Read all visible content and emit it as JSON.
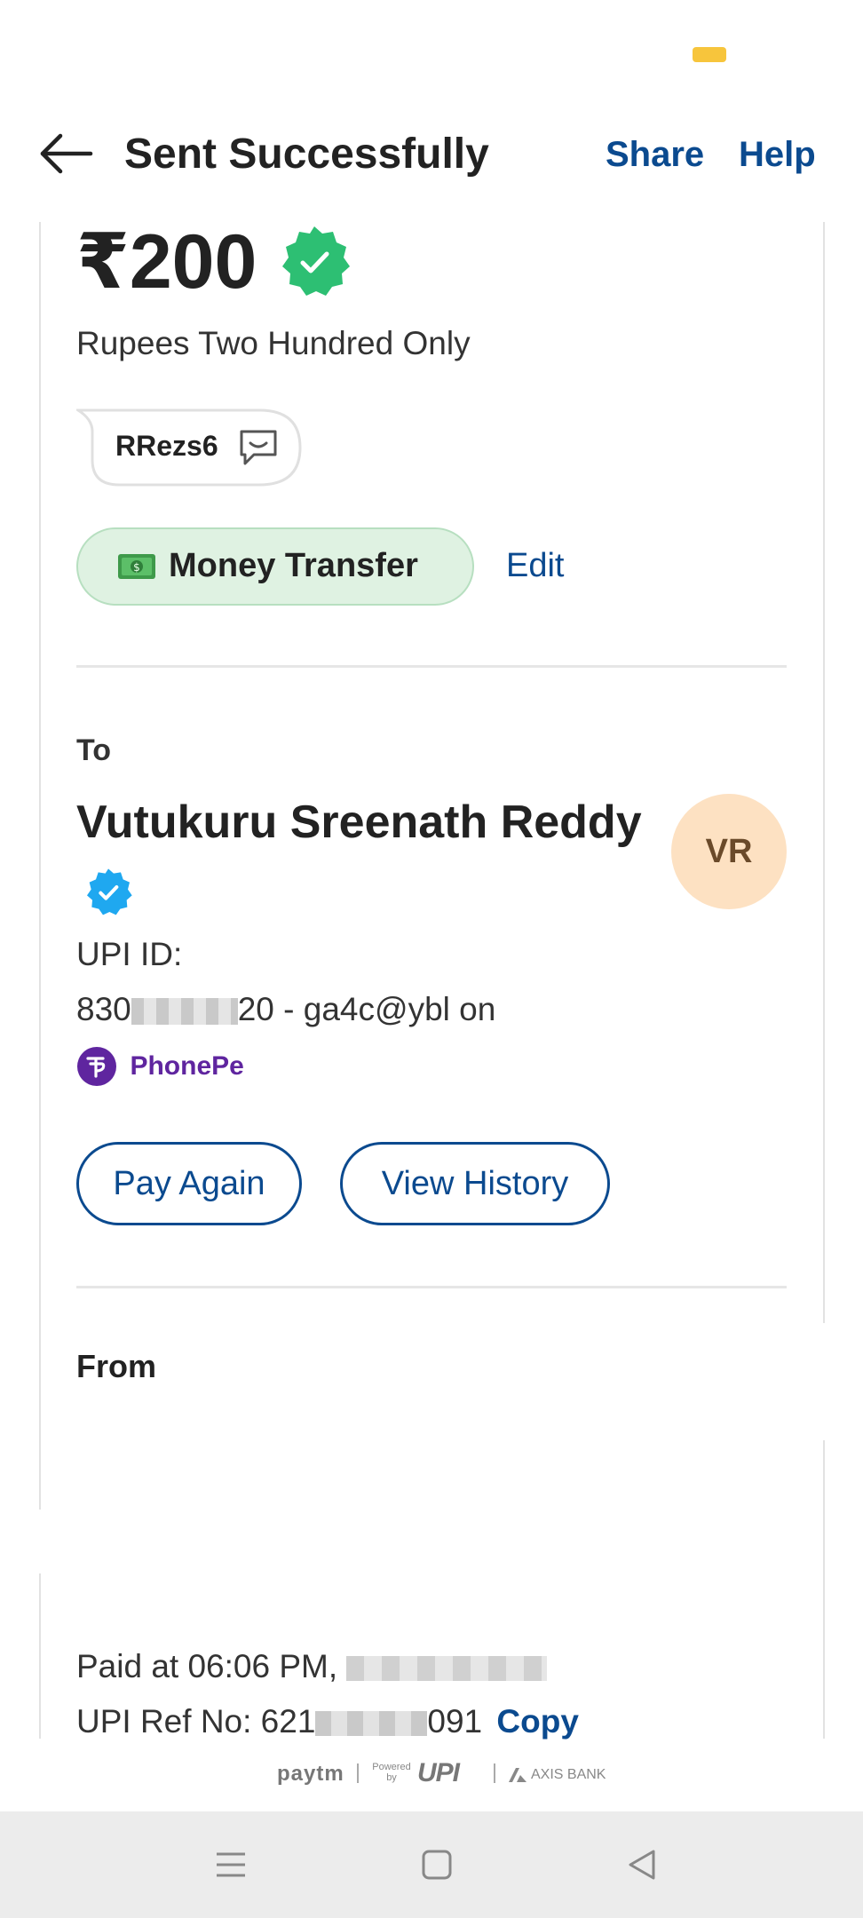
{
  "header": {
    "title": "Sent Successfully",
    "share_label": "Share",
    "help_label": "Help"
  },
  "payment": {
    "amount": "₹200",
    "amount_words": "Rupees Two Hundred Only",
    "note": "RRezs6",
    "category": "Money Transfer",
    "edit_label": "Edit"
  },
  "recipient": {
    "to_label": "To",
    "name": "Vutukuru Sreenath Reddy",
    "avatar_initials": "VR",
    "upi_label": "UPI ID:",
    "upi_prefix": "830",
    "upi_suffix": "20 - ga4c@ybl on",
    "app_name": "PhonePe",
    "pay_again_label": "Pay Again",
    "view_history_label": "View History"
  },
  "sender": {
    "from_label": "From"
  },
  "details": {
    "paid_at_prefix": "Paid at 06:06 PM,",
    "ref_prefix": "UPI Ref No: 621",
    "ref_suffix": "091",
    "copy_label": "Copy"
  },
  "footer": {
    "paytm": "paytm",
    "powered_by": "Powered by",
    "upi": "UPI",
    "bank": "AXIS BANK"
  },
  "colors": {
    "link_blue": "#0b4a8f",
    "verified_green": "#2dbf73",
    "verified_blue": "#1fa8f0",
    "phonepe_purple": "#5f259f",
    "chip_green_bg": "#dff2e2",
    "avatar_bg": "#fde1c2"
  },
  "icons": {
    "back": "arrow-left-icon",
    "verified": "verified-badge-icon",
    "comment": "comment-icon",
    "money": "money-icon",
    "phonepe": "phonepe-logo-icon",
    "nav_menu": "menu-icon",
    "nav_home": "home-square-icon",
    "nav_back": "back-triangle-icon"
  }
}
